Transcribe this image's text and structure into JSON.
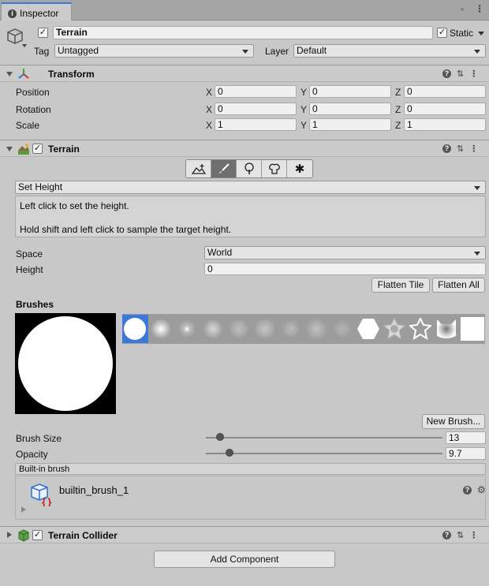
{
  "window": {
    "tab_label": "Inspector"
  },
  "gameobject": {
    "name": "Terrain",
    "static_label": "Static",
    "tag_label": "Tag",
    "tag_value": "Untagged",
    "layer_label": "Layer",
    "layer_value": "Default"
  },
  "transform": {
    "title": "Transform",
    "rows": [
      {
        "label": "Position",
        "x": "0",
        "y": "0",
        "z": "0"
      },
      {
        "label": "Rotation",
        "x": "0",
        "y": "0",
        "z": "0"
      },
      {
        "label": "Scale",
        "x": "1",
        "y": "1",
        "z": "1"
      }
    ],
    "axis": {
      "x": "X",
      "y": "Y",
      "z": "Z"
    }
  },
  "terrain": {
    "title": "Terrain",
    "mode": "Set Height",
    "help_line1": "Left click to set the height.",
    "help_line2": "Hold shift and left click to sample the target height.",
    "space_label": "Space",
    "space_value": "World",
    "height_label": "Height",
    "height_value": "0",
    "flatten_tile": "Flatten Tile",
    "flatten_all": "Flatten All",
    "brushes_label": "Brushes",
    "new_brush": "New Brush...",
    "brush_size_label": "Brush Size",
    "brush_size_value": "13",
    "brush_size_fraction": 0.06,
    "opacity_label": "Opacity",
    "opacity_value": "9.7",
    "opacity_fraction": 0.1,
    "builtin_label": "Built-in brush",
    "brush_asset_name": "builtin_brush_1"
  },
  "collider": {
    "title": "Terrain Collider"
  },
  "add_component": "Add Component",
  "colors": {
    "accent": "#3a79d8",
    "panel": "#c8c8c8"
  }
}
